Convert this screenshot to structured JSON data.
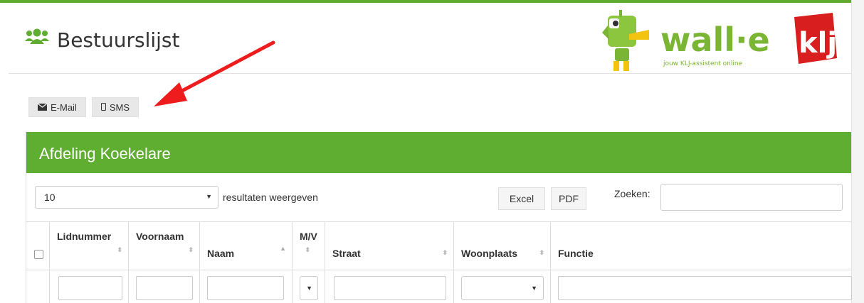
{
  "header": {
    "title": "Bestuurslijst"
  },
  "logo": {
    "wordmark": "wall·e",
    "tagline": "jouw KLJ-assistent online",
    "badge": "klj"
  },
  "toolbar": {
    "email_label": "E-Mail",
    "sms_label": "SMS"
  },
  "panel": {
    "heading": "Afdeling Koekelare"
  },
  "table_controls": {
    "length_value": "10",
    "length_label": "resultaten weergeven",
    "excel_label": "Excel",
    "pdf_label": "PDF",
    "search_label": "Zoeken:"
  },
  "table": {
    "columns": [
      {
        "label": "Lidnummer"
      },
      {
        "label": "Voornaam"
      },
      {
        "label": "Naam"
      },
      {
        "label": "M/V"
      },
      {
        "label": "Straat"
      },
      {
        "label": "Woonplaats"
      },
      {
        "label": "Functie"
      }
    ]
  },
  "colors": {
    "brand_green": "#5fae31",
    "annotation_red": "#ee1c1c"
  },
  "icons": [
    "users-icon",
    "envelope-icon",
    "mobile-icon",
    "sort-icon",
    "arrow-annotation"
  ]
}
